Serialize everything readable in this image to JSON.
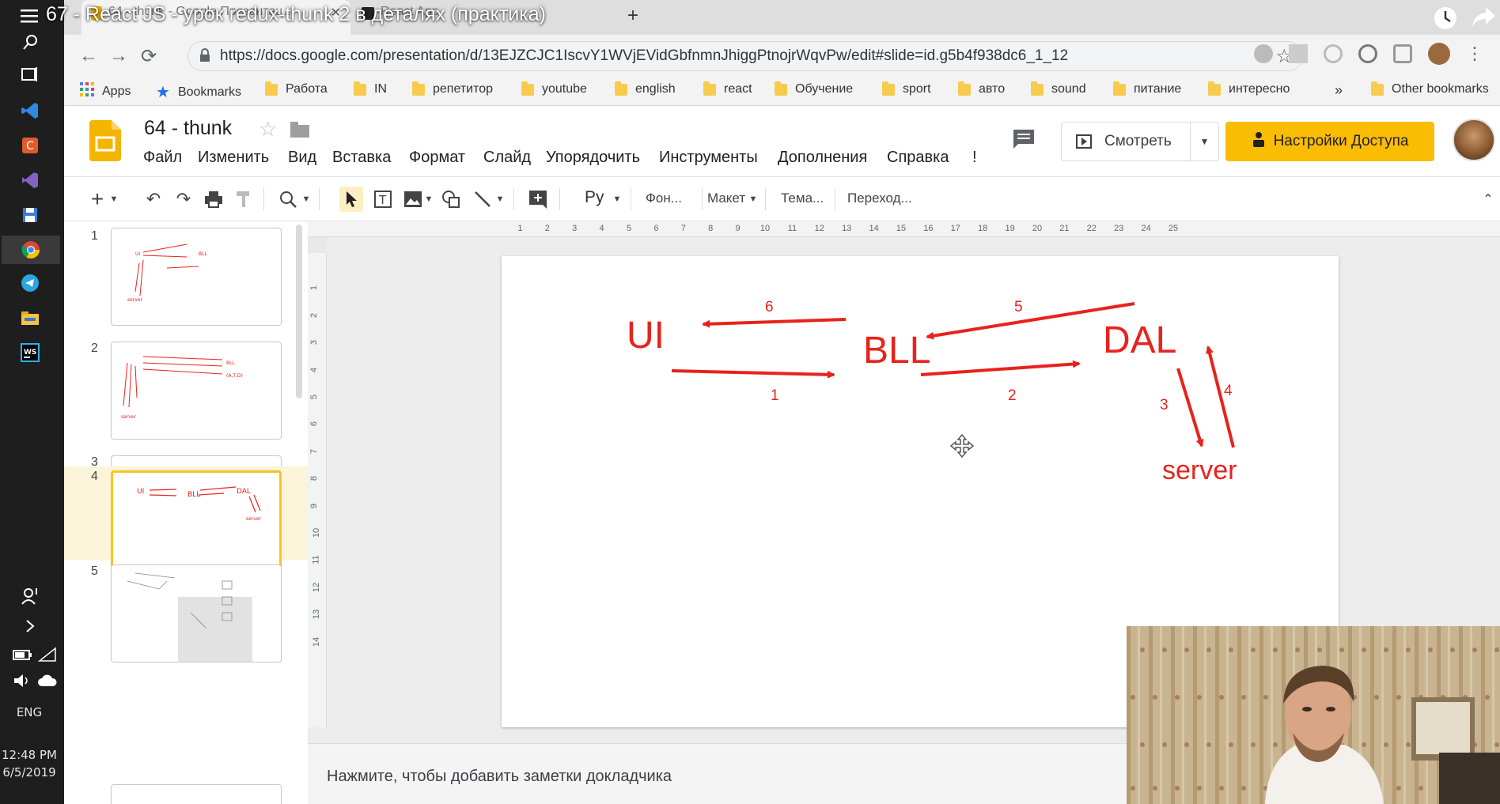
{
  "video": {
    "title": "67 - React JS - урок redux-thunk 2 в деталях (практика)"
  },
  "browser": {
    "tabs": [
      {
        "label": "64 - thunk - Google Презентац…"
      },
      {
        "label": "React App"
      }
    ],
    "url": "https://docs.google.com/presentation/d/13EJZCJC1IscvY1WVjEVidGbfnmnJhiggPtnojrWqvPw/edit#slide=id.g5b4f938dc6_1_12",
    "bookmarks": [
      {
        "label": "Apps",
        "icon": "apps-grid-icon"
      },
      {
        "label": "Bookmarks",
        "icon": "star-icon"
      },
      {
        "label": "Работа"
      },
      {
        "label": "IN"
      },
      {
        "label": "репетитор"
      },
      {
        "label": "youtube"
      },
      {
        "label": "english"
      },
      {
        "label": "react"
      },
      {
        "label": "Обучение"
      },
      {
        "label": "sport"
      },
      {
        "label": "авто"
      },
      {
        "label": "sound"
      },
      {
        "label": "питание"
      },
      {
        "label": "интересно"
      }
    ],
    "more": "»",
    "other_bookmarks": "Other bookmarks"
  },
  "slides": {
    "doc_title": "64 - thunk",
    "menus": [
      "Файл",
      "Изменить",
      "Вид",
      "Вставка",
      "Формат",
      "Слайд",
      "Упорядочить",
      "Инструменты",
      "Дополнения",
      "Справка",
      "!"
    ],
    "watch_label": "Смотреть",
    "share_label": "Настройки Доступа",
    "toolbar": {
      "input_tools": "Ру",
      "background": "Фон...",
      "layout": "Макет",
      "theme": "Тема...",
      "transition": "Переход..."
    },
    "ruler_top": [
      "1",
      "2",
      "3",
      "4",
      "5",
      "6",
      "7",
      "8",
      "9",
      "10",
      "11",
      "12",
      "13",
      "14",
      "15",
      "16",
      "17",
      "18",
      "19",
      "20",
      "21",
      "22",
      "23",
      "24",
      "25"
    ],
    "ruler_left": [
      "1",
      "2",
      "3",
      "4",
      "5",
      "6",
      "7",
      "8",
      "9",
      "10",
      "11",
      "12",
      "13",
      "14"
    ],
    "thumbnails": [
      {
        "number": "1"
      },
      {
        "number": "2"
      },
      {
        "number": "3"
      },
      {
        "number": "4"
      },
      {
        "number": "5"
      }
    ],
    "current_slide": {
      "nodes": {
        "ui": "UI",
        "bll": "BLL",
        "dal": "DAL",
        "server": "server"
      },
      "arrow_labels": [
        "1",
        "2",
        "3",
        "4",
        "5",
        "6"
      ],
      "color": "#e8221c"
    },
    "notes_placeholder": "Нажмите, чтобы добавить заметки докладчика"
  },
  "taskbar": {
    "language": "ENG",
    "time": "12:48 PM",
    "date": "6/5/2019"
  },
  "colors": {
    "share": "#fbbc04",
    "taskbar": "#1e1e1e",
    "diagram": "#e8221c",
    "active_thumb": "#f7c325"
  }
}
